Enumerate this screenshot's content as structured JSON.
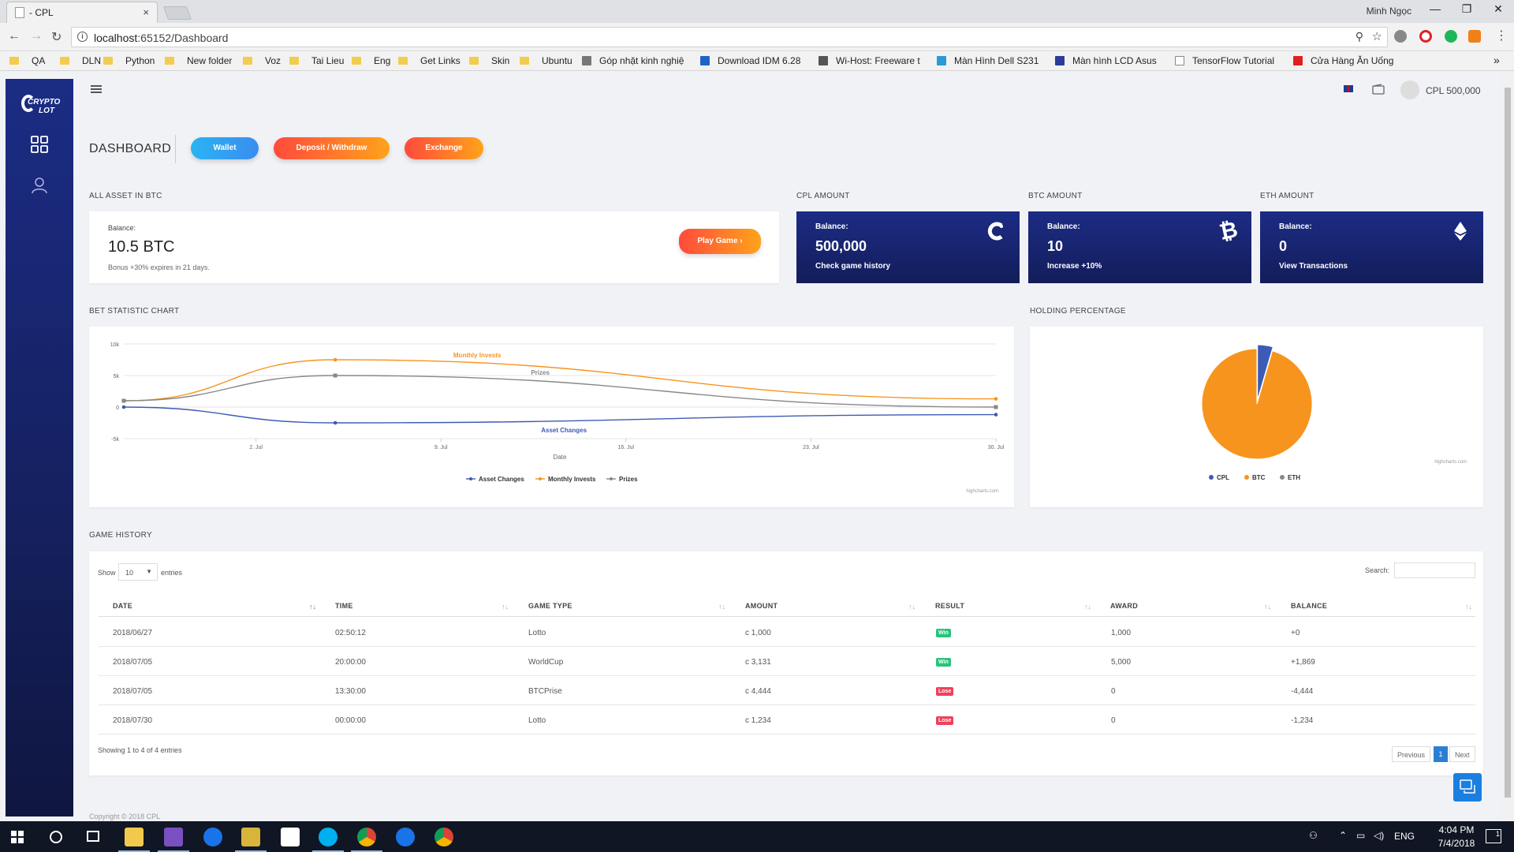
{
  "browser": {
    "tab_title": "- CPL",
    "tab_close": "×",
    "user_name": "Minh Ngọc",
    "url_host": "localhost",
    "url_rest": ":65152/Dashboard",
    "bookmarks": [
      "QA",
      "DLN",
      "Python",
      "New folder",
      "Voz",
      "Tai Lieu",
      "Eng",
      "Get Links",
      "Skin",
      "Ubuntu",
      "Góp nhặt kinh nghiệ",
      "Download IDM 6.28",
      "Wi-Host: Freeware t",
      "Màn Hình Dell S231",
      "Màn hình LCD Asus",
      "TensorFlow Tutorial",
      "Cửa Hàng Ăn Uống"
    ],
    "bookmarks_more": "»"
  },
  "sidebar": {
    "logo_top": "CRYPTO",
    "logo_bottom": "LOT",
    "icons": [
      "dashboard-grid-icon",
      "user-icon"
    ]
  },
  "header": {
    "flag": "uk-flag-icon",
    "wallet_icon": "wallet-icon",
    "balance": "CPL 500,000"
  },
  "dashboard": {
    "title": "DASHBOARD",
    "buttons": {
      "wallet": "Wallet",
      "deposit": "Deposit / Withdraw",
      "exchange": "Exchange"
    }
  },
  "all_asset": {
    "section": "ALL ASSET IN BTC",
    "balance_label": "Balance:",
    "balance_value": "10.5 BTC",
    "bonus": "Bonus +30% expires in 21 days.",
    "play_button": "Play Game"
  },
  "amount_cards": [
    {
      "section": "CPL AMOUNT",
      "label": "Balance:",
      "value": "500,000",
      "sub": "Check game history",
      "icon": "cpl-coin-icon"
    },
    {
      "section": "BTC AMOUNT",
      "label": "Balance:",
      "value": "10",
      "sub": "Increase +10%",
      "icon": "bitcoin-icon"
    },
    {
      "section": "ETH AMOUNT",
      "label": "Balance:",
      "value": "0",
      "sub": "View Transactions",
      "icon": "ethereum-icon"
    }
  ],
  "colors": {
    "accent_blue": "#2a3dd1",
    "card_navy": "#1a2878",
    "orange": "#ff6a2b",
    "orange_light": "#ffa31a",
    "win": "#27c47c",
    "lose": "#f0405a",
    "cyan": "#2ab4f2"
  },
  "bet_chart_section": "BET STATISTIC CHART",
  "holding_section": "HOLDING PERCENTAGE",
  "chart_data": [
    {
      "type": "line",
      "title": "",
      "xlabel": "Date",
      "ylabel": "",
      "x_ticks": [
        "2. Jul",
        "9. Jul",
        "16. Jul",
        "23. Jul",
        "30. Jul"
      ],
      "y_ticks": [
        "10k",
        "5k",
        "0",
        "-5k"
      ],
      "ylim": [
        -5000,
        10000
      ],
      "x": [
        "2018-06-27",
        "2018-07-05",
        "2018-07-05",
        "2018-07-30"
      ],
      "series": [
        {
          "name": "Asset Changes",
          "color": "#3d5bb5",
          "values": [
            0,
            -2500,
            -2500,
            -1200
          ]
        },
        {
          "name": "Monthly Invests",
          "color": "#f7941e",
          "values": [
            1000,
            7500,
            7500,
            1300
          ]
        },
        {
          "name": "Prizes",
          "color": "#888888",
          "values": [
            1000,
            5000,
            5000,
            0
          ]
        }
      ],
      "legend": "bottom",
      "credit": "highcharts.com"
    },
    {
      "type": "pie",
      "title": "",
      "labels": [
        "CPL",
        "BTC",
        "ETH"
      ],
      "colors": [
        "#3d5bb5",
        "#f7941e",
        "#888888"
      ],
      "values": [
        4.5,
        95.5,
        0
      ],
      "legend": "bottom",
      "credit": "highcharts.com"
    }
  ],
  "game_history": {
    "section": "GAME HISTORY",
    "show_label": "Show",
    "entries_value": "10",
    "entries_label": "entries",
    "search_label": "Search:",
    "columns": [
      "DATE",
      "TIME",
      "GAME TYPE",
      "AMOUNT",
      "RESULT",
      "AWARD",
      "BALANCE"
    ],
    "rows": [
      {
        "date": "2018/06/27",
        "time": "02:50:12",
        "game": "Lotto",
        "amount": "1,000",
        "result": "Win",
        "award": "1,000",
        "balance": "+0"
      },
      {
        "date": "2018/07/05",
        "time": "20:00:00",
        "game": "WorldCup",
        "amount": "3,131",
        "result": "Win",
        "award": "5,000",
        "balance": "+1,869"
      },
      {
        "date": "2018/07/05",
        "time": "13:30:00",
        "game": "BTCPrise",
        "amount": "4,444",
        "result": "Lose",
        "award": "0",
        "balance": "-4,444"
      },
      {
        "date": "2018/07/30",
        "time": "00:00:00",
        "game": "Lotto",
        "amount": "1,234",
        "result": "Lose",
        "award": "0",
        "balance": "-1,234"
      }
    ],
    "info": "Showing 1 to 4 of 4 entries",
    "pagination": {
      "prev": "Previous",
      "page": "1",
      "next": "Next"
    }
  },
  "footer": "Copyright © 2018 CPL",
  "taskbar": {
    "lang": "ENG",
    "time": "4:04 PM",
    "date": "7/4/2018",
    "notifications": "1"
  }
}
